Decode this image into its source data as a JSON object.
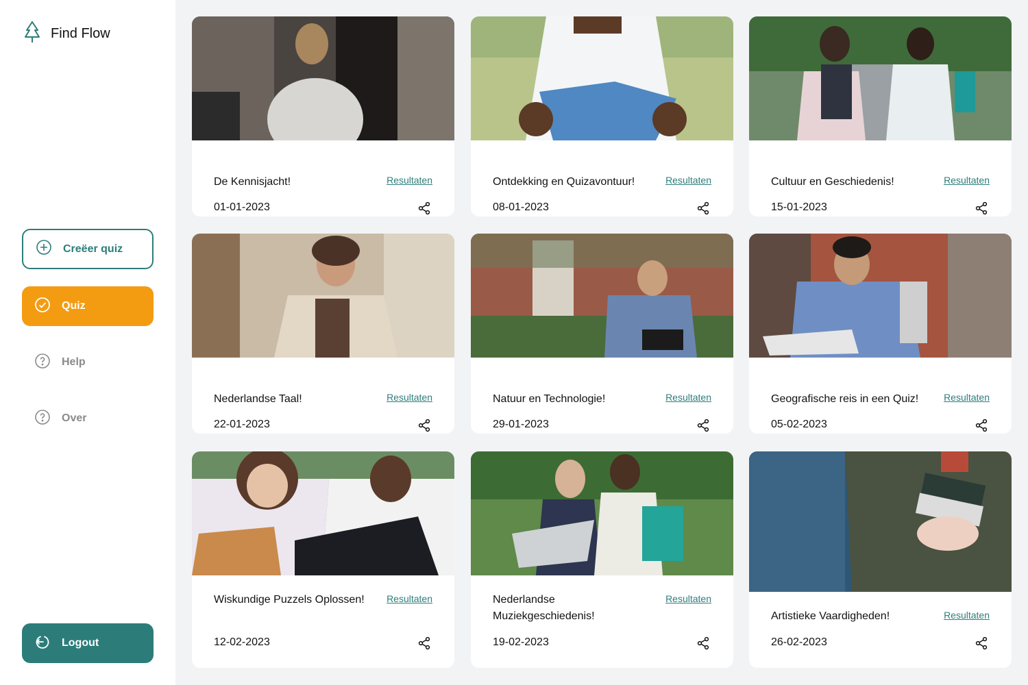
{
  "app": {
    "name": "Find Flow",
    "accent": "#2c7d7a",
    "highlight": "#f39c12"
  },
  "nav": {
    "create_label": "Creëer quiz",
    "quiz_label": "Quiz",
    "help_label": "Help",
    "over_label": "Over",
    "logout_label": "Logout"
  },
  "cards": [
    {
      "title": "De Kennisjacht!",
      "date": "01-01-2023",
      "link": "Resultaten"
    },
    {
      "title": "Ontdekking en Quizavontuur!",
      "date": "08-01-2023",
      "link": "Resultaten"
    },
    {
      "title": "Cultuur en Geschiedenis!",
      "date": "15-01-2023",
      "link": "Resultaten"
    },
    {
      "title": "Nederlandse Taal!",
      "date": "22-01-2023",
      "link": "Resultaten"
    },
    {
      "title": "Natuur en Technologie!",
      "date": "29-01-2023",
      "link": "Resultaten"
    },
    {
      "title": "Geografische reis in een Quiz!",
      "date": "05-02-2023",
      "link": "Resultaten"
    },
    {
      "title": "Wiskundige Puzzels Oplossen!",
      "date": "12-02-2023",
      "link": "Resultaten"
    },
    {
      "title": "Nederlandse Muziekgeschiedenis!",
      "date": "19-02-2023",
      "link": "Resultaten"
    },
    {
      "title": "Artistieke Vaardigheden!",
      "date": "26-02-2023",
      "link": "Resultaten"
    }
  ]
}
